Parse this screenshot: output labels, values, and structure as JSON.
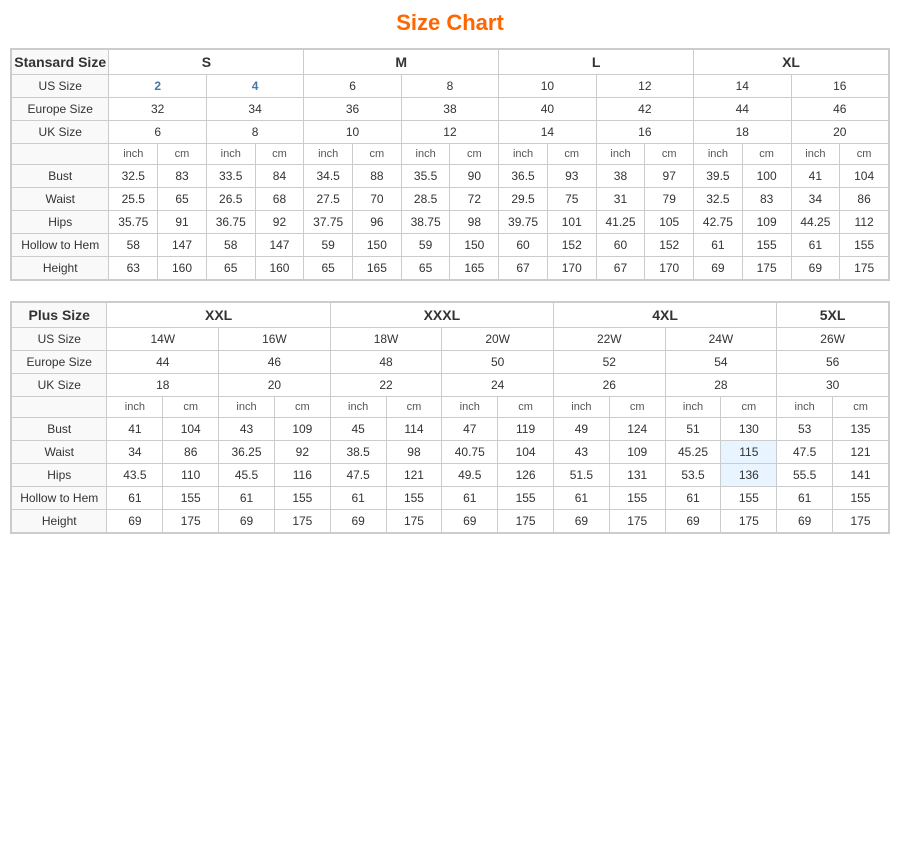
{
  "title": "Size Chart",
  "standard": {
    "headers": {
      "col1": "Stansard Size",
      "s": "S",
      "m": "M",
      "l": "L",
      "xl": "XL"
    },
    "us_size_label": "US Size",
    "us_sizes": [
      "2",
      "4",
      "6",
      "8",
      "10",
      "12",
      "14",
      "16"
    ],
    "europe_size_label": "Europe Size",
    "europe_sizes": [
      "32",
      "34",
      "36",
      "38",
      "40",
      "42",
      "44",
      "46"
    ],
    "uk_size_label": "UK Size",
    "uk_sizes": [
      "6",
      "8",
      "10",
      "12",
      "14",
      "16",
      "18",
      "20"
    ],
    "unit_row": [
      "inch",
      "cm",
      "inch",
      "cm",
      "inch",
      "cm",
      "inch",
      "cm",
      "inch",
      "cm",
      "inch",
      "cm",
      "inch",
      "cm",
      "inch",
      "cm"
    ],
    "rows": [
      {
        "label": "Bust",
        "vals": [
          "32.5",
          "83",
          "33.5",
          "84",
          "34.5",
          "88",
          "35.5",
          "90",
          "36.5",
          "93",
          "38",
          "97",
          "39.5",
          "100",
          "41",
          "104"
        ]
      },
      {
        "label": "Waist",
        "vals": [
          "25.5",
          "65",
          "26.5",
          "68",
          "27.5",
          "70",
          "28.5",
          "72",
          "29.5",
          "75",
          "31",
          "79",
          "32.5",
          "83",
          "34",
          "86"
        ]
      },
      {
        "label": "Hips",
        "vals": [
          "35.75",
          "91",
          "36.75",
          "92",
          "37.75",
          "96",
          "38.75",
          "98",
          "39.75",
          "101",
          "41.25",
          "105",
          "42.75",
          "109",
          "44.25",
          "112"
        ]
      },
      {
        "label": "Hollow to Hem",
        "vals": [
          "58",
          "147",
          "58",
          "147",
          "59",
          "150",
          "59",
          "150",
          "60",
          "152",
          "60",
          "152",
          "61",
          "155",
          "61",
          "155"
        ]
      },
      {
        "label": "Height",
        "vals": [
          "63",
          "160",
          "65",
          "160",
          "65",
          "165",
          "65",
          "165",
          "67",
          "170",
          "67",
          "170",
          "69",
          "175",
          "69",
          "175"
        ]
      }
    ]
  },
  "plus": {
    "headers": {
      "col1": "Plus Size",
      "xxl": "XXL",
      "xxxl": "XXXL",
      "4xl": "4XL",
      "5xl": "5XL"
    },
    "us_size_label": "US Size",
    "us_sizes": [
      "14W",
      "16W",
      "18W",
      "20W",
      "22W",
      "24W",
      "26W"
    ],
    "europe_size_label": "Europe Size",
    "europe_sizes": [
      "44",
      "46",
      "48",
      "50",
      "52",
      "54",
      "56"
    ],
    "uk_size_label": "UK Size",
    "uk_sizes": [
      "18",
      "20",
      "22",
      "24",
      "26",
      "28",
      "30"
    ],
    "unit_row": [
      "inch",
      "cm",
      "inch",
      "cm",
      "inch",
      "cm",
      "inch",
      "cm",
      "inch",
      "cm",
      "inch",
      "cm",
      "inch",
      "cm"
    ],
    "rows": [
      {
        "label": "Bust",
        "vals": [
          "41",
          "104",
          "43",
          "109",
          "45",
          "114",
          "47",
          "119",
          "49",
          "124",
          "51",
          "130",
          "53",
          "135"
        ]
      },
      {
        "label": "Waist",
        "vals": [
          "34",
          "86",
          "36.25",
          "92",
          "38.5",
          "98",
          "40.75",
          "104",
          "43",
          "109",
          "45.25",
          "115",
          "47.5",
          "121"
        ]
      },
      {
        "label": "Hips",
        "vals": [
          "43.5",
          "110",
          "45.5",
          "116",
          "47.5",
          "121",
          "49.5",
          "126",
          "51.5",
          "131",
          "53.5",
          "136",
          "55.5",
          "141"
        ]
      },
      {
        "label": "Hollow to Hem",
        "vals": [
          "61",
          "155",
          "61",
          "155",
          "61",
          "155",
          "61",
          "155",
          "61",
          "155",
          "61",
          "155",
          "61",
          "155"
        ]
      },
      {
        "label": "Height",
        "vals": [
          "69",
          "175",
          "69",
          "175",
          "69",
          "175",
          "69",
          "175",
          "69",
          "175",
          "69",
          "175",
          "69",
          "175"
        ]
      }
    ]
  }
}
